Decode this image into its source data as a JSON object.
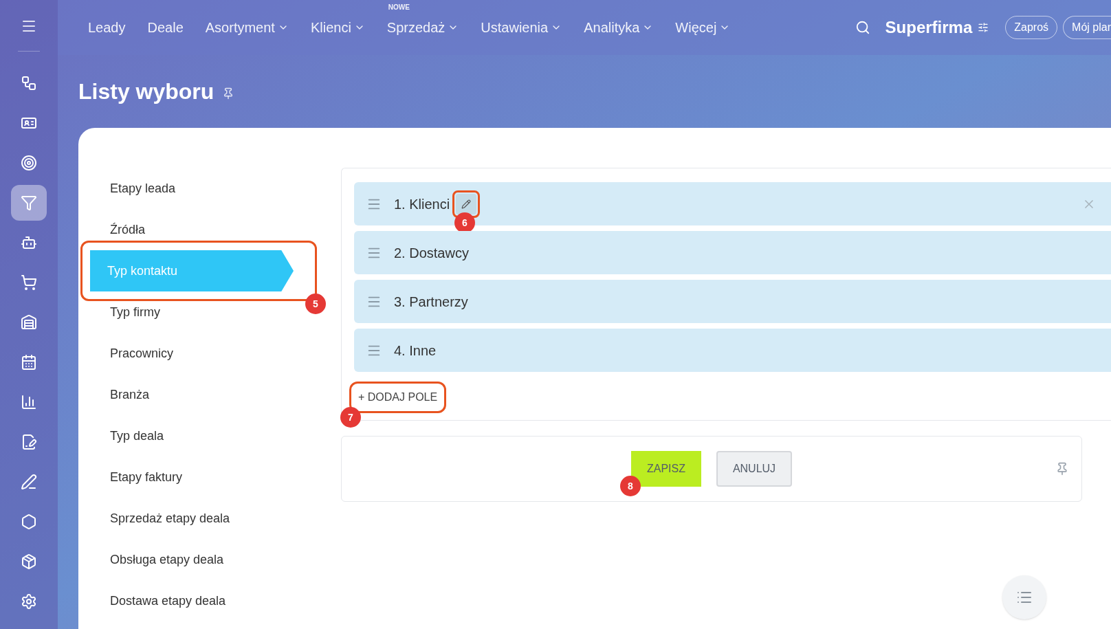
{
  "rail": {
    "items": [
      {
        "selected": false
      },
      {
        "selected": false
      },
      {
        "selected": false
      },
      {
        "selected": true
      },
      {
        "selected": false
      },
      {
        "selected": false
      },
      {
        "selected": false
      },
      {
        "selected": false
      },
      {
        "selected": false
      },
      {
        "selected": false
      },
      {
        "selected": false
      },
      {
        "selected": false
      },
      {
        "selected": false
      },
      {
        "selected": false
      }
    ]
  },
  "topnav": {
    "items": [
      {
        "label": "Leady",
        "dropdown": false
      },
      {
        "label": "Deale",
        "dropdown": false
      },
      {
        "label": "Asortyment",
        "dropdown": true
      },
      {
        "label": "Klienci",
        "dropdown": true
      },
      {
        "label": "Sprzedaż",
        "dropdown": true,
        "tag": "NOWE"
      },
      {
        "label": "Ustawienia",
        "dropdown": true
      },
      {
        "label": "Analityka",
        "dropdown": true
      },
      {
        "label": "Więcej",
        "dropdown": true
      }
    ],
    "company": "Superfirma",
    "invite": "Zaproś",
    "plan": "Mój plar"
  },
  "page": {
    "title": "Listy wyboru"
  },
  "menu": {
    "items": [
      {
        "label": "Etapy leada",
        "selected": false
      },
      {
        "label": "Źródła",
        "selected": false
      },
      {
        "label": "Typ kontaktu",
        "selected": true,
        "callout": "5"
      },
      {
        "label": "Typ firmy",
        "selected": false
      },
      {
        "label": "Pracownicy",
        "selected": false
      },
      {
        "label": "Branża",
        "selected": false
      },
      {
        "label": "Typ deala",
        "selected": false
      },
      {
        "label": "Etapy faktury",
        "selected": false
      },
      {
        "label": "Sprzedaż etapy deala",
        "selected": false
      },
      {
        "label": "Obsługa etapy deala",
        "selected": false
      },
      {
        "label": "Dostawa etapy deala",
        "selected": false
      }
    ]
  },
  "list": {
    "rows": [
      {
        "label": "1. Klienci",
        "hovered": true,
        "callout": "6"
      },
      {
        "label": "2. Dostawcy",
        "hovered": false
      },
      {
        "label": "3. Partnerzy",
        "hovered": false
      },
      {
        "label": "4. Inne",
        "hovered": false
      }
    ],
    "add_button": {
      "label": "+ DODAJ POLE",
      "callout": "7"
    }
  },
  "footer": {
    "save": {
      "label": "ZAPISZ",
      "callout": "8"
    },
    "cancel": {
      "label": "ANULUJ"
    }
  }
}
